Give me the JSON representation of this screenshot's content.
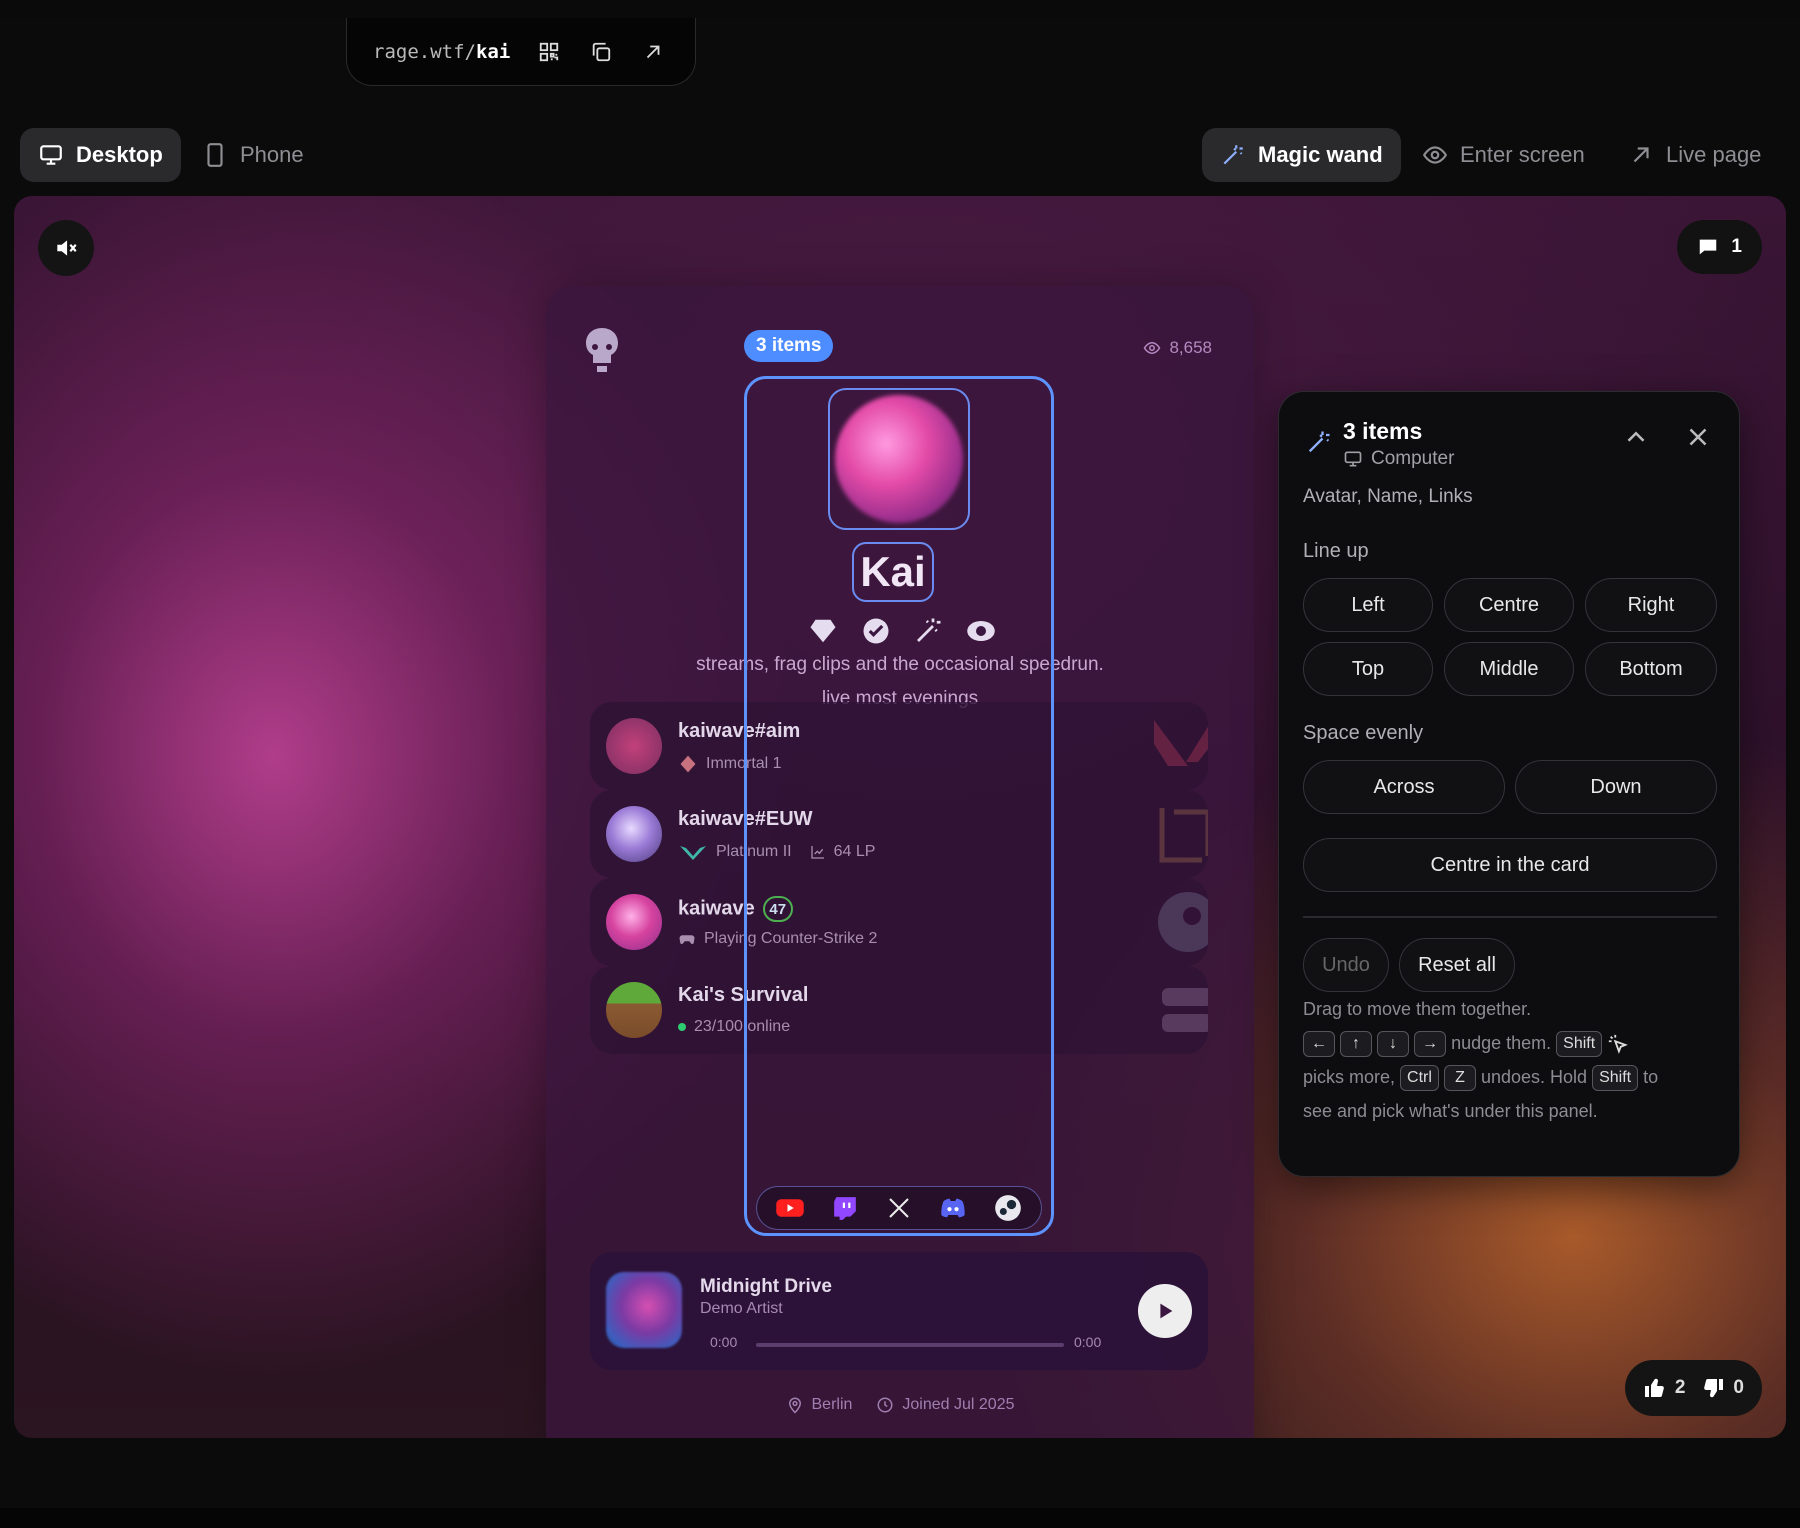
{
  "urlbar": {
    "prefix": "rage.wtf/",
    "slug": "kai"
  },
  "toolbar": {
    "desktop": "Desktop",
    "phone": "Phone",
    "magic_wand": "Magic wand",
    "enter_screen": "Enter screen",
    "live_page": "Live page"
  },
  "stage": {
    "comments_count": "1",
    "likes": "2",
    "dislikes": "0"
  },
  "profile": {
    "views": "8,658",
    "selection_badge": "3 items",
    "name": "Kai",
    "bio_line1": "streams, frag clips and the occasional speedrun.",
    "bio_line2": "live most evenings",
    "widgets": [
      {
        "title": "kaiwave#aim",
        "sub": "Immortal 1"
      },
      {
        "title": "kaiwave#EUW",
        "sub": "Platinum II",
        "extra": "64 LP"
      },
      {
        "title": "kaiwave",
        "level": "47",
        "sub": "Playing Counter-Strike 2"
      },
      {
        "title": "Kai's Survival",
        "sub": "23/100 online"
      }
    ],
    "player": {
      "title": "Midnight Drive",
      "artist": "Demo Artist",
      "elapsed": "0:00",
      "duration": "0:00"
    },
    "footer": {
      "location": "Berlin",
      "joined": "Joined Jul 2025"
    }
  },
  "panel": {
    "title": "3 items",
    "device": "Computer",
    "items": "Avatar, Name, Links",
    "line_up_label": "Line up",
    "line_up": [
      "Left",
      "Centre",
      "Right",
      "Top",
      "Middle",
      "Bottom"
    ],
    "space_label": "Space evenly",
    "space": [
      "Across",
      "Down"
    ],
    "centre_card": "Centre in the card",
    "undo": "Undo",
    "reset": "Reset all",
    "help_1": "Drag to move them together.",
    "help_2": "nudge them.",
    "help_3": "picks more,",
    "help_4": "undoes. Hold",
    "help_5": "to",
    "help_6": "see and pick what's under this panel.",
    "keys": {
      "left": "←",
      "up": "↑",
      "down": "↓",
      "right": "→",
      "shift": "Shift",
      "ctrl": "Ctrl",
      "z": "Z"
    }
  },
  "colors": {
    "accent": "#5d93ff",
    "panel_bg": "#0d0d0f",
    "online": "#2ecc71"
  }
}
